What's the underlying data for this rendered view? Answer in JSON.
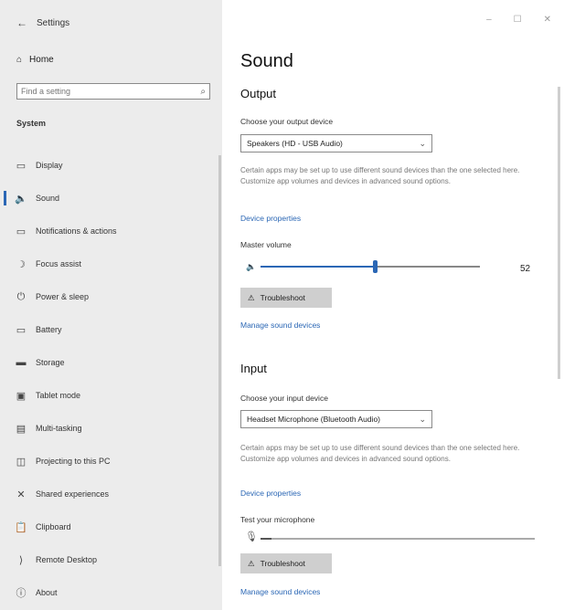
{
  "window": {
    "title": "Settings"
  },
  "sidebar": {
    "home_label": "Home",
    "search_placeholder": "Find a setting",
    "section_label": "System",
    "items": [
      {
        "label": "Display",
        "icon": "display-icon",
        "glyph": "▭"
      },
      {
        "label": "Sound",
        "icon": "speaker-icon",
        "glyph": "🔈",
        "selected": true
      },
      {
        "label": "Notifications & actions",
        "icon": "notifications-icon",
        "glyph": "▭"
      },
      {
        "label": "Focus assist",
        "icon": "moon-icon",
        "glyph": "☽"
      },
      {
        "label": "Power & sleep",
        "icon": "power-icon",
        "glyph": "⏻"
      },
      {
        "label": "Battery",
        "icon": "battery-icon",
        "glyph": "▭"
      },
      {
        "label": "Storage",
        "icon": "storage-icon",
        "glyph": "▬"
      },
      {
        "label": "Tablet mode",
        "icon": "tablet-icon",
        "glyph": "▣"
      },
      {
        "label": "Multi-tasking",
        "icon": "multitasking-icon",
        "glyph": "▤"
      },
      {
        "label": "Projecting to this PC",
        "icon": "projecting-icon",
        "glyph": "◫"
      },
      {
        "label": "Shared experiences",
        "icon": "shared-icon",
        "glyph": "✕"
      },
      {
        "label": "Clipboard",
        "icon": "clipboard-icon",
        "glyph": "📋"
      },
      {
        "label": "Remote Desktop",
        "icon": "remote-desktop-icon",
        "glyph": "⟩"
      },
      {
        "label": "About",
        "icon": "info-icon",
        "glyph": "ⓘ"
      }
    ]
  },
  "main": {
    "title": "Sound",
    "output": {
      "heading": "Output",
      "device_label": "Choose your output device",
      "device_value": "Speakers (HD - USB Audio)",
      "description": "Certain apps may be set up to use different sound devices than the one selected here. Customize app volumes and devices in advanced sound options.",
      "device_properties": "Device properties",
      "volume_label": "Master volume",
      "volume_value": "52",
      "volume_fraction": 0.52,
      "troubleshoot": "Troubleshoot",
      "manage": "Manage sound devices"
    },
    "input": {
      "heading": "Input",
      "device_label": "Choose your input device",
      "device_value": "Headset Microphone (Bluetooth Audio)",
      "description": "Certain apps may be set up to use different sound devices than the one selected here. Customize app volumes and devices in advanced sound options.",
      "device_properties": "Device properties",
      "test_label": "Test your microphone",
      "mic_level": 0.04,
      "troubleshoot": "Troubleshoot",
      "manage": "Manage sound devices"
    }
  },
  "colors": {
    "accent": "#2b67b5",
    "sidebar_bg": "#ececec"
  }
}
